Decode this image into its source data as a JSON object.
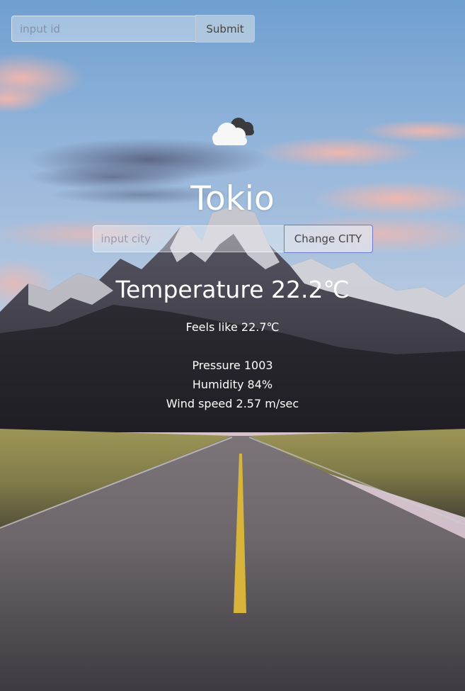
{
  "id_form": {
    "input_placeholder": "input id",
    "submit_label": "Submit"
  },
  "weather": {
    "icon": "cloud-icon",
    "city": "Tokio",
    "city_input_placeholder": "input city",
    "change_city_label": "Change CITY",
    "temperature": "Temperature 22.2℃",
    "feels_like": "Feels like 22.7℃",
    "pressure": "Pressure 1003",
    "humidity": "Humidity 84%",
    "wind_speed": "Wind speed 2.57 m/sec"
  },
  "colors": {
    "accent_border": "#6f79c9",
    "text": "#ffffff"
  }
}
